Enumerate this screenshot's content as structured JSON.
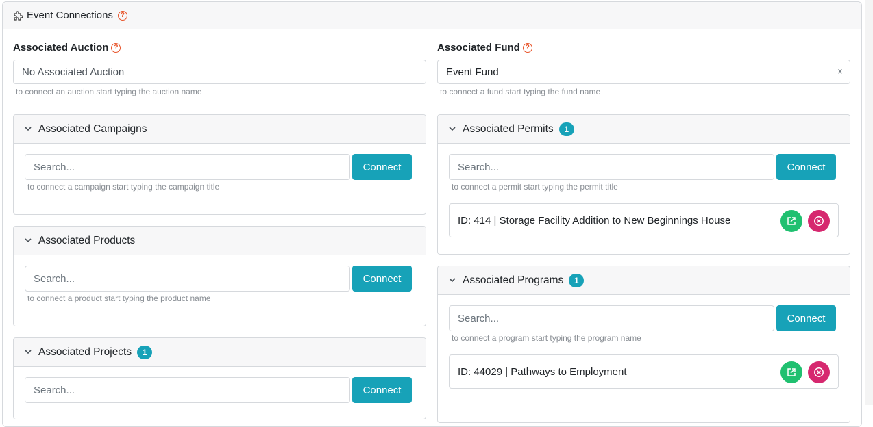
{
  "header": {
    "title": "Event Connections",
    "icon": "puzzle-icon",
    "help": "?"
  },
  "auction": {
    "label": "Associated Auction",
    "value": "No Associated Auction",
    "hint": "to connect an auction start typing the auction name"
  },
  "fund": {
    "label": "Associated Fund",
    "value": "Event Fund",
    "clear": "×",
    "hint": "to connect a fund start typing the fund name"
  },
  "panels": {
    "campaigns": {
      "title": "Associated Campaigns",
      "placeholder": "Search...",
      "connect": "Connect",
      "hint": "to connect a campaign start typing the campaign title"
    },
    "products": {
      "title": "Associated Products",
      "placeholder": "Search...",
      "connect": "Connect",
      "hint": "to connect a product start typing the product name"
    },
    "projects": {
      "title": "Associated Projects",
      "badge": "1",
      "placeholder": "Search...",
      "connect": "Connect"
    },
    "permits": {
      "title": "Associated Permits",
      "badge": "1",
      "placeholder": "Search...",
      "connect": "Connect",
      "hint": "to connect a permit start typing the permit title",
      "items": [
        "ID: 414 | Storage Facility Addition to New Beginnings House"
      ]
    },
    "programs": {
      "title": "Associated Programs",
      "badge": "1",
      "placeholder": "Search...",
      "connect": "Connect",
      "hint": "to connect a program start typing the program name",
      "items": [
        "ID: 44029 | Pathways to Employment"
      ]
    }
  },
  "colors": {
    "accent": "#17a2b8",
    "help": "#e8542a",
    "open": "#20c070",
    "remove": "#d6286f"
  }
}
